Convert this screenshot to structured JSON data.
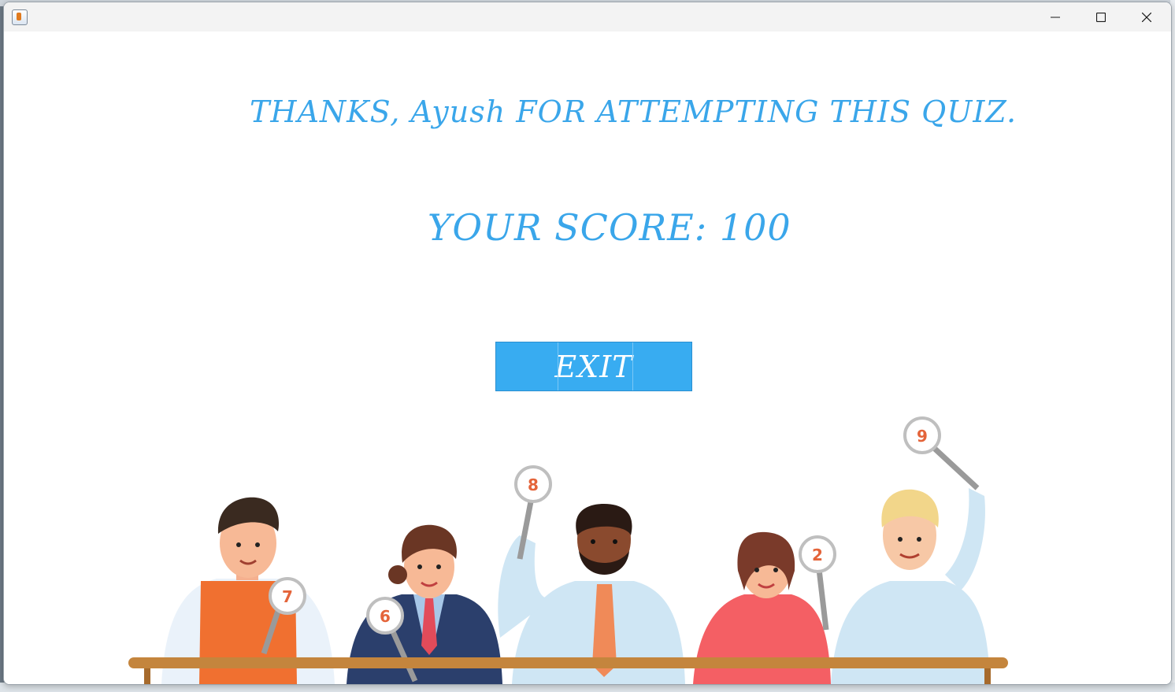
{
  "window": {
    "title": "",
    "controls": {
      "minimize": "minimize-icon",
      "maximize": "maximize-icon",
      "close": "close-icon"
    }
  },
  "result": {
    "thanks_text": "THANKS, Ayush  FOR ATTEMPTING THIS QUIZ.",
    "score_text": "YOUR SCORE:  100",
    "exit_label": "EXIT"
  },
  "illustration": {
    "paddles": [
      "7",
      "6",
      "8",
      "2",
      "9"
    ]
  },
  "colors": {
    "accent_text": "#3aa6ea",
    "button_bg": "#38acf1",
    "paddle_number": "#e4643a"
  }
}
